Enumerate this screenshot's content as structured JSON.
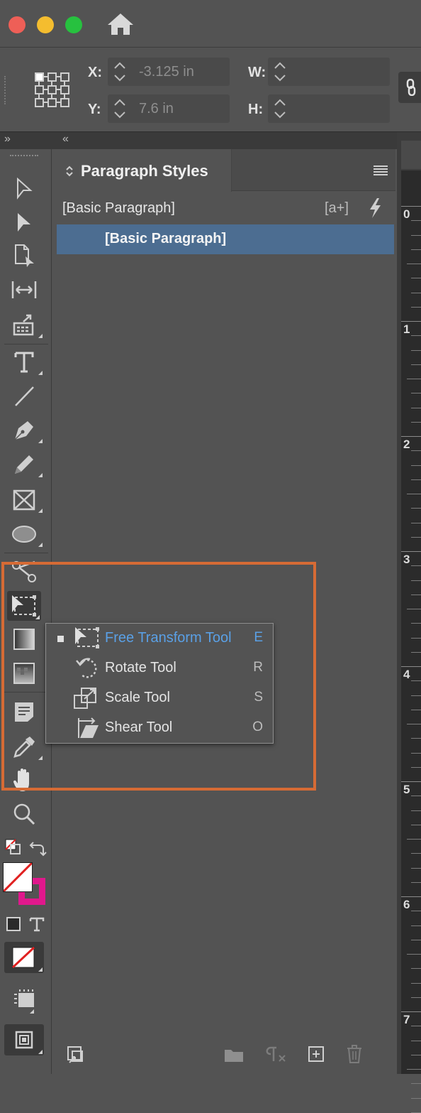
{
  "toolbar": {
    "x_label": "X:",
    "x_value": "-3.125 in",
    "y_label": "Y:",
    "y_value": "7.6 in",
    "w_label": "W:",
    "w_value": "",
    "h_label": "H:",
    "h_value": "",
    "collapse_left": "»",
    "collapse_right": "«"
  },
  "panel": {
    "title": "Paragraph Styles",
    "current_style": "[Basic Paragraph]",
    "new_style_icon_text": "[a+]",
    "styles": [
      {
        "label": "[Basic Paragraph]",
        "selected": true
      }
    ]
  },
  "flyout": {
    "items": [
      {
        "label": "Free Transform Tool",
        "shortcut": "E",
        "active": true,
        "icon": "free-transform-icon"
      },
      {
        "label": "Rotate Tool",
        "shortcut": "R",
        "active": false,
        "icon": "rotate-icon"
      },
      {
        "label": "Scale Tool",
        "shortcut": "S",
        "active": false,
        "icon": "scale-icon"
      },
      {
        "label": "Shear Tool",
        "shortcut": "O",
        "active": false,
        "icon": "shear-icon"
      }
    ]
  },
  "ruler": {
    "labels": [
      "0",
      "1",
      "2",
      "3",
      "4",
      "5",
      "6",
      "7"
    ]
  },
  "colors": {
    "highlight": "#d66b35",
    "selected_row": "#4c6d91",
    "active_flyout_text": "#5aa0e6",
    "stroke_swatch": "#e0188c"
  }
}
